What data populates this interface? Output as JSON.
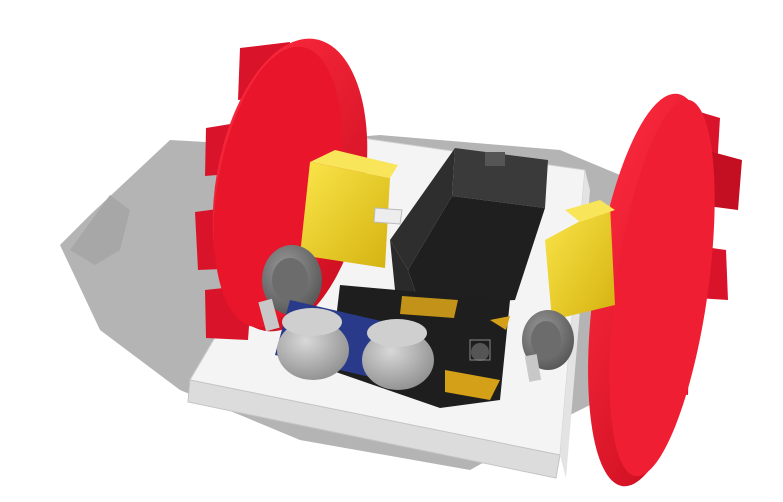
{
  "scene": {
    "colors": {
      "background": "#ffffff",
      "shadow": "#9a9a9a",
      "base_top": "#f2f2f2",
      "base_side": "#d9d9d9",
      "wheel": "#e8152b",
      "wheel_dark": "#b80f1f",
      "motor": "#f2d21a",
      "motor_dark": "#c9a90c",
      "motor_cap": "#8a8a8a",
      "battery": "#2a2a2a",
      "battery_top": "#3b3b3b",
      "sensor_board": "#2a3a8a",
      "sensor_cyl": "#a9a9a9",
      "microbit": "#222222",
      "microbit_gold": "#d4a017"
    },
    "icons": [
      "wheel",
      "motor",
      "battery-pack",
      "ultrasonic-sensor",
      "microbit-board",
      "chassis-base"
    ]
  }
}
